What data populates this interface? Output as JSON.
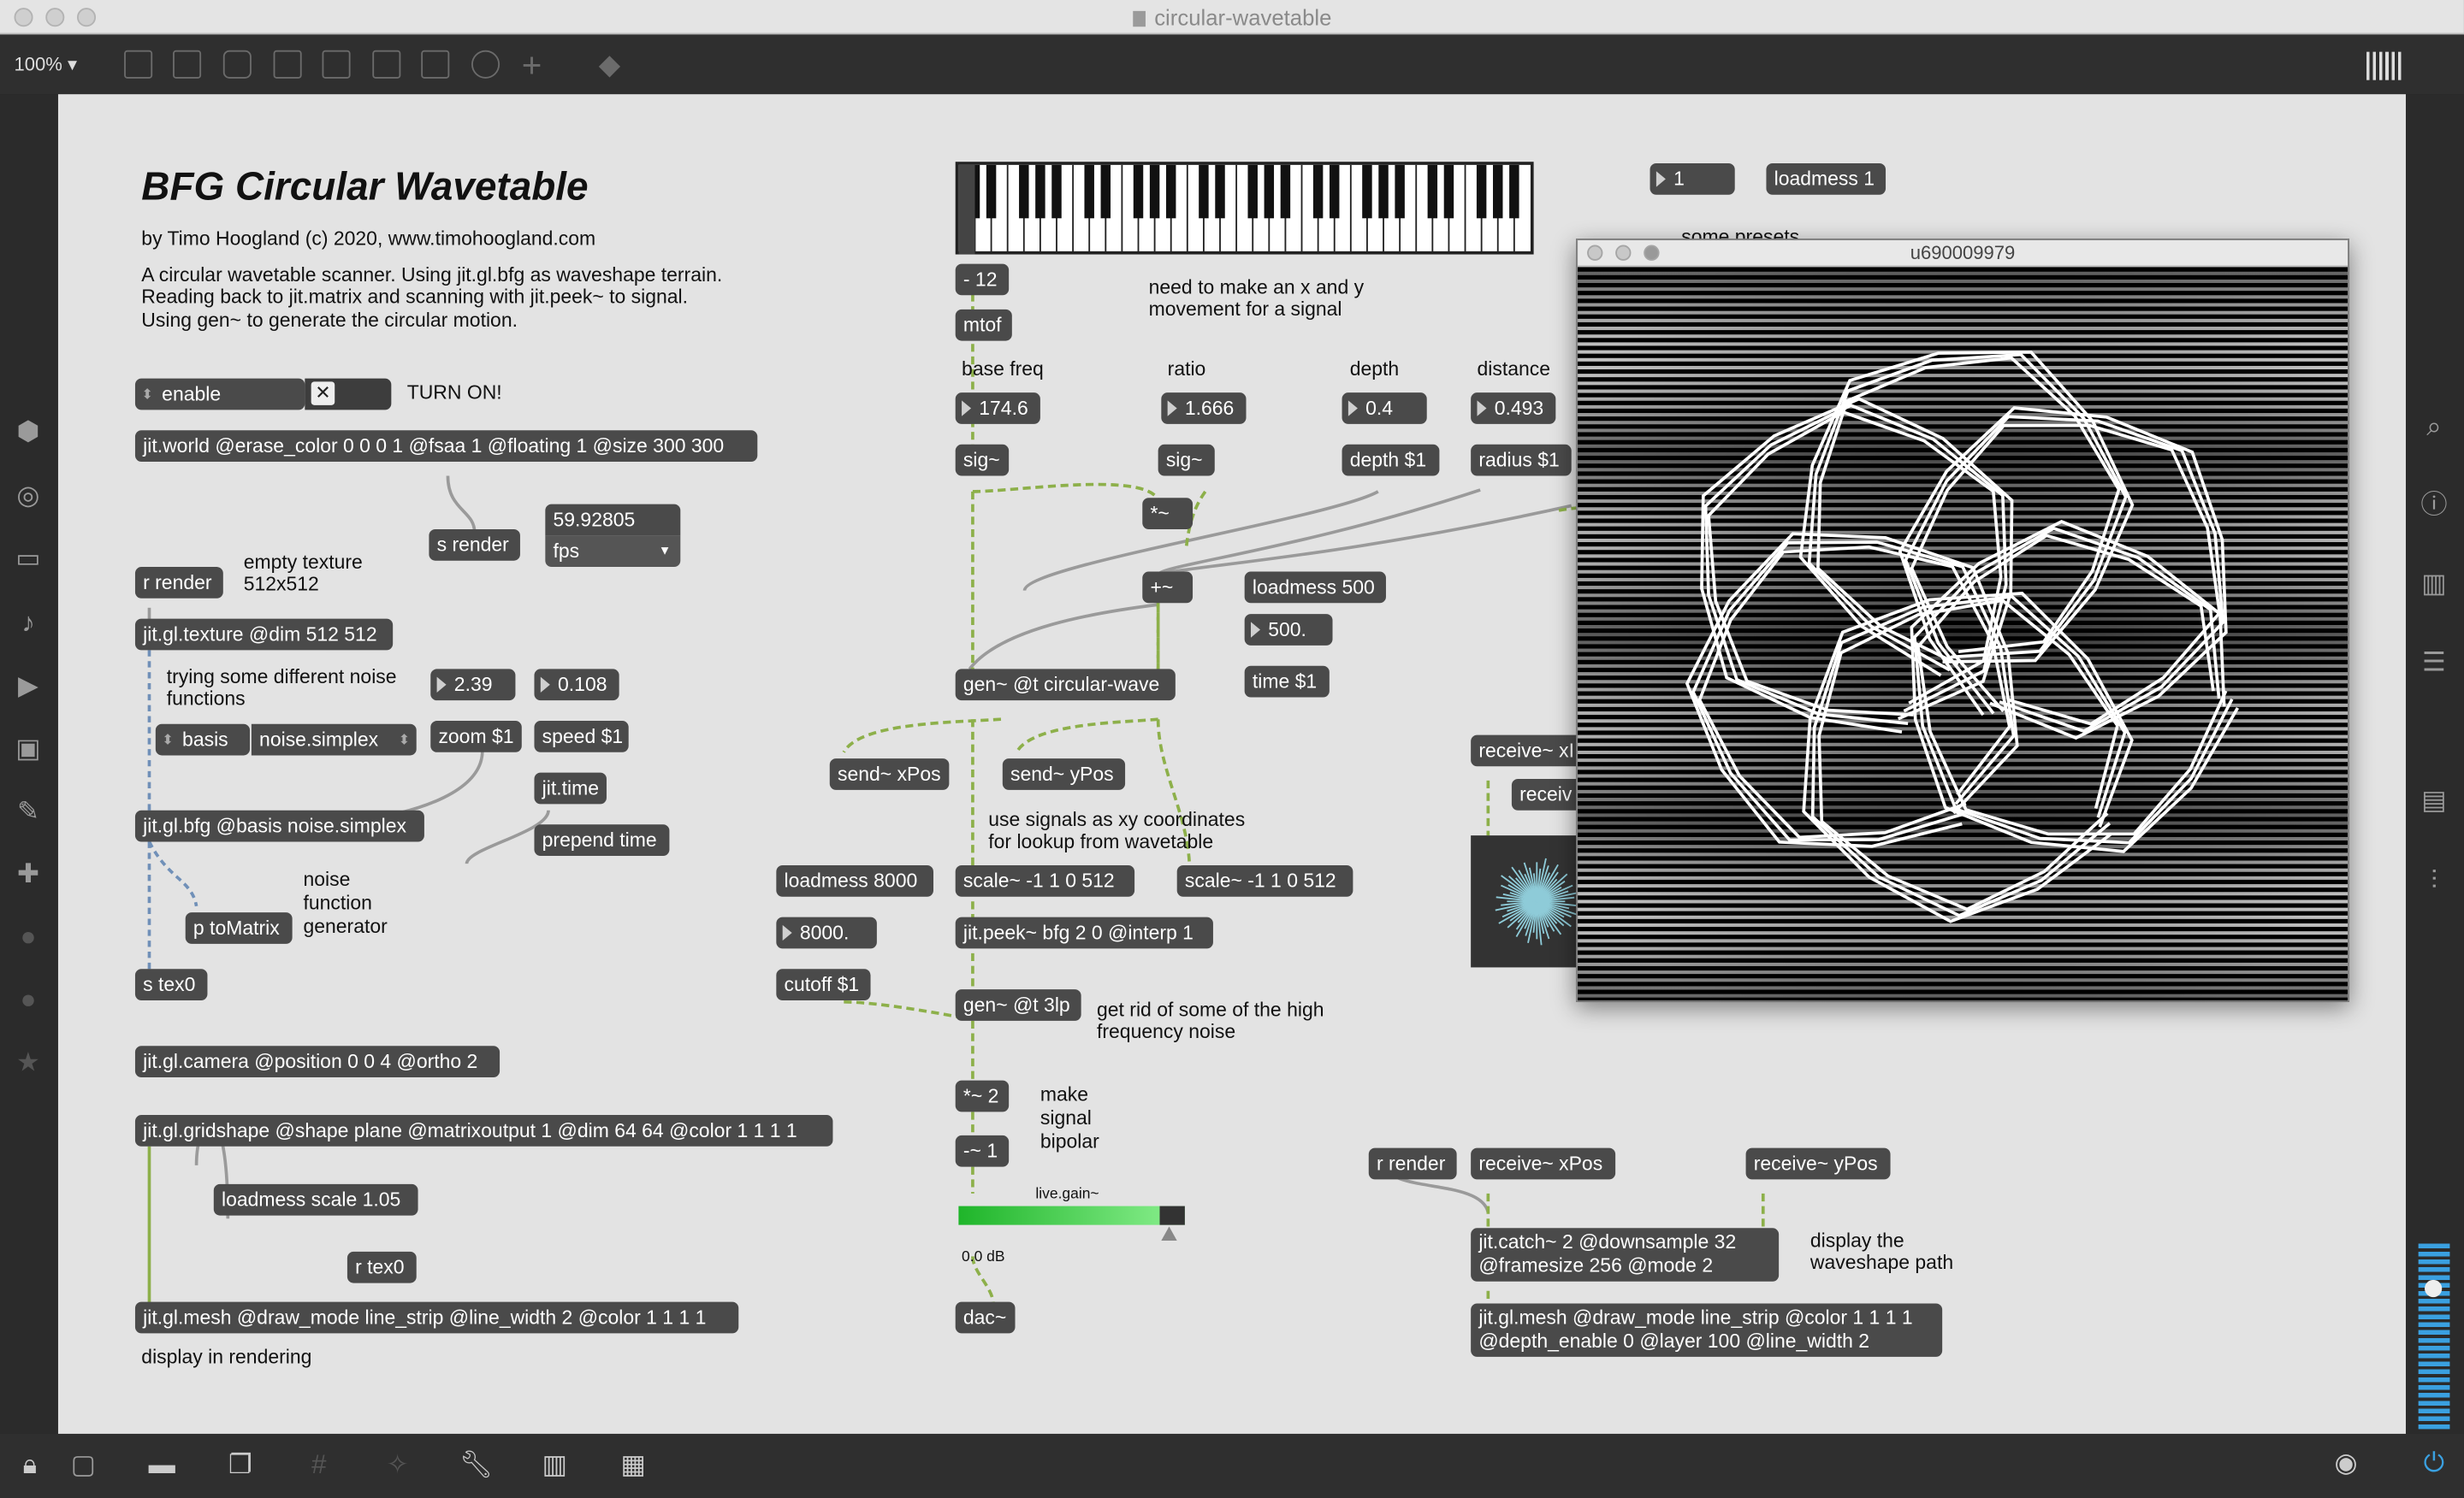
{
  "window": {
    "title": "circular-wavetable"
  },
  "toolbar": {
    "zoom": "100%"
  },
  "patch": {
    "heading": "BFG Circular Wavetable",
    "byline": "by Timo Hoogland (c) 2020, www.timohoogland.com",
    "desc1": "A circular wavetable scanner. Using jit.gl.bfg as waveshape terrain.",
    "desc2": "Reading back to jit.matrix and scanning with jit.peek~ to signal.",
    "desc3": "Using gen~ to generate the circular motion.",
    "enable_label": "enable",
    "toggle_glyph": "✕",
    "turn_on": "TURN ON!",
    "jit_world": "jit.world @erase_color 0 0 0 1 @fsaa 1 @floating 1 @size 300 300",
    "fps_value": "59.92805",
    "fps_label": "fps",
    "s_render": "s render",
    "r_render": "r render",
    "empty_texture_1": "empty texture",
    "empty_texture_2": "512x512",
    "jit_texture": "jit.gl.texture @dim 512 512",
    "noise_cmt_1": "trying some different noise",
    "noise_cmt_2": "functions",
    "num_zoom": "2.39",
    "num_speed": "0.108",
    "basis_label": "basis",
    "basis_value": "noise.simplex",
    "zoom_msg": "zoom $1",
    "speed_msg": "speed $1",
    "jit_time": "jit.time",
    "jit_bfg": "jit.gl.bfg @basis noise.simplex",
    "prepend_time": "prepend time",
    "nfg_1": "noise",
    "nfg_2": "function",
    "nfg_3": "generator",
    "p_tomatrix": "p toMatrix",
    "s_tex0": "s tex0",
    "jit_camera": "jit.gl.camera @position 0 0 4 @ortho 2",
    "jit_gridshape": "jit.gl.gridshape @shape plane @matrixoutput 1 @dim 64 64 @color 1 1 1 1",
    "loadmess_scale": "loadmess scale 1.05",
    "r_tex0": "r tex0",
    "jit_mesh": "jit.gl.mesh @draw_mode line_strip @line_width 2 @color 1 1 1 1",
    "display_rendering": "display in rendering",
    "minus12": "- 12",
    "mtof": "mtof",
    "xy_cmt_1": "need to make an x and y",
    "xy_cmt_2": "movement for a signal",
    "base_freq": "base freq",
    "ratio": "ratio",
    "depth": "depth",
    "distance": "distance",
    "num_freq": "174.6",
    "num_ratio": "1.666",
    "num_depth": "0.4",
    "num_distance": "0.493",
    "sig1": "sig~",
    "sig2": "sig~",
    "depth_msg": "depth $1",
    "radius_msg": "radius $1",
    "times": "*~",
    "plus": "+~",
    "loadmess500": "loadmess 500",
    "num500": "500.",
    "time_msg": "time $1",
    "gen_circ": "gen~ @t circular-wave",
    "send_xpos": "send~ xPos",
    "send_ypos": "send~ yPos",
    "lookup_1": "use signals as xy coordinates",
    "lookup_2": "for lookup from wavetable",
    "loadmess8000": "loadmess 8000",
    "scale_x": "scale~ -1 1 0 512",
    "scale_y": "scale~ -1 1 0 512",
    "num8000": "8000.",
    "jit_peek": "jit.peek~ bfg 2 0 @interp 1",
    "cutoff": "cutoff $1",
    "gen_3lp": "gen~ @t 3lp",
    "hf_1": "get rid of some of the high",
    "hf_2": "frequency noise",
    "times2": "*~ 2",
    "minus1": "-~ 1",
    "bip_1": "make",
    "bip_2": "signal",
    "bip_3": "bipolar",
    "live_gain": "live.gain~",
    "gain_db": "0.0 dB",
    "dac": "dac~",
    "num1": "1",
    "loadmess1": "loadmess 1",
    "presets": "some presets",
    "receive_x_partial": "receive~ xI",
    "receive_partial": "receiv",
    "r_render2": "r render",
    "receive_xpos": "receive~ xPos",
    "receive_ypos": "receive~ yPos",
    "catch_1": "jit.catch~ 2 @downsample 32",
    "catch_2": "@framesize 256 @mode 2",
    "wave_1": "display the",
    "wave_2": "waveshape path",
    "mesh2_1": "jit.gl.mesh @draw_mode line_strip @color 1 1 1 1",
    "mesh2_2": "@depth_enable 0 @layer 100 @line_width 2"
  },
  "render_window": {
    "title": "u690009979"
  },
  "colors": {
    "canvas": "#e3e3e3",
    "object": "#4a4a4a",
    "signal_wire": "#8db04a",
    "meter": "#3ecf4a"
  }
}
